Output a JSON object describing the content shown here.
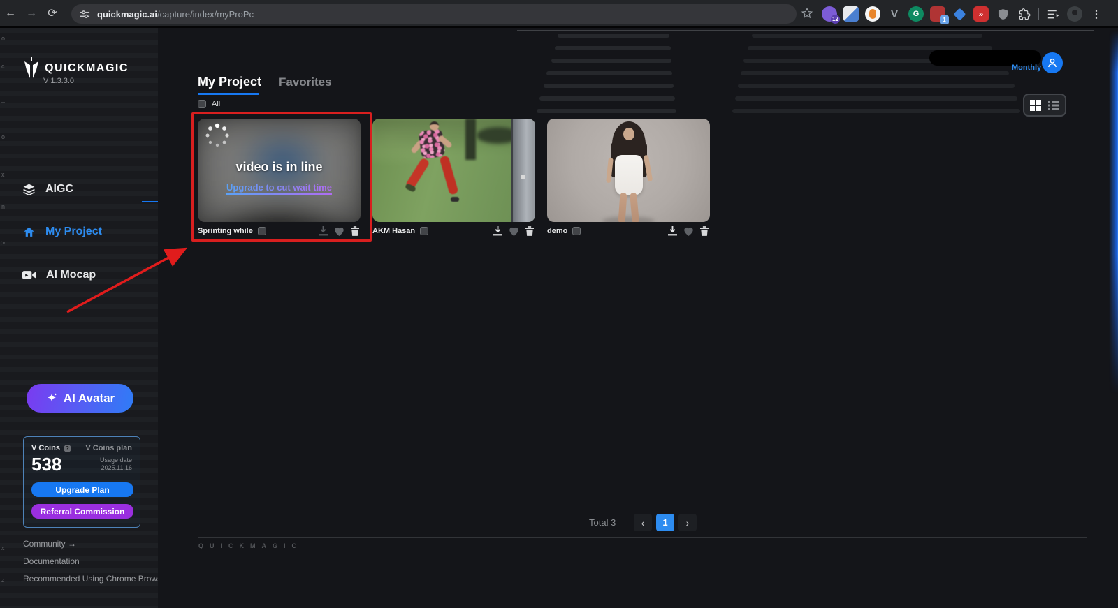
{
  "browser": {
    "url": {
      "site": "quickmagic.ai",
      "path": "/capture/index/myProPc"
    },
    "badges": {
      "ext1": "12",
      "ext2": "1"
    }
  },
  "icons_glyphs": {
    "back": "←",
    "forward": "→",
    "reload": "⟳",
    "menu": "⋮",
    "question": "?",
    "prev": "‹",
    "next": "›",
    "v_ext": "V",
    "g_ext": "G",
    "red_ext": "»"
  },
  "sidebar": {
    "logo": "QUICKMAGIC",
    "version": "V 1.3.3.0",
    "nav": [
      {
        "label": "AIGC"
      },
      {
        "label": "My Project"
      },
      {
        "label": "AI Mocap"
      }
    ],
    "ai_avatar": "AI Avatar",
    "vcoins": {
      "title": "V Coins",
      "plan": "V Coins plan",
      "balance": "538",
      "usage_label": "Usage date",
      "usage_date": "2025.11.16",
      "upgrade": "Upgrade Plan",
      "referral": "Referral Commission"
    },
    "links": {
      "community": "Community →",
      "documentation": "Documentation",
      "chrome_note": "Recommended Using Chrome Browser"
    }
  },
  "header": {
    "plan": "Monthly"
  },
  "content": {
    "tabs": {
      "my_project": "My Project",
      "favorites": "Favorites"
    },
    "all_label": "All",
    "cards": [
      {
        "title": "Sprinting while",
        "status": "video is in line",
        "link": "Upgrade to cut wait time"
      },
      {
        "title": "AKM Hasan"
      },
      {
        "title": "demo"
      }
    ],
    "pagination": {
      "total": "Total 3",
      "page": "1"
    },
    "watermark": "QUICKMAGIC"
  },
  "edge_glyphs": [
    "o",
    "c",
    "–",
    "o",
    "x",
    "n",
    ">",
    "x",
    "z"
  ],
  "colors": {
    "accent": "#2d8cf0",
    "upgrade_btn": "#1778f2",
    "referral_btn": "#9a2fe0",
    "annotation_red": "#d81f1f",
    "link_gradient_start": "#5aa2f7",
    "link_gradient_end": "#b06cf2"
  }
}
